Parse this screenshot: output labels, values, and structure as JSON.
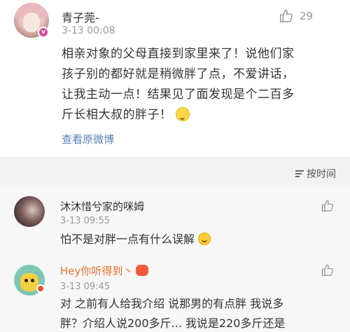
{
  "main_post": {
    "username": "青子莞-",
    "timestamp": "3-13 00:08",
    "like_count": "29",
    "text_line1": "相亲对象的父母直接到家里来了！说他们家",
    "text_line2": "孩子别的都好就是稍微胖了点，不爱讲话，",
    "text_line3": "让我主动一点！结果见了面发现是个二百多",
    "text_line4": "斤长相大叔的胖子！",
    "view_original_label": "查看原微博",
    "verified_badge": "v"
  },
  "sort_button": {
    "label": "按时间"
  },
  "comments": [
    {
      "username": "沐沐惜兮家的咪姆",
      "timestamp": "3-13 09:55",
      "text": "怕不是对胖一点有什么误解"
    },
    {
      "username": "Hey你听得到丶",
      "timestamp": "3-13 09:45",
      "text_line1": "对 之前有人给我介绍 说那男的有点胖 我说多",
      "text_line2": "胖？介绍人说200多斤... 我说是220多斤还是"
    }
  ],
  "colors": {
    "link": "#5a7fb5",
    "highlight_name": "#e8742d",
    "band": "#f2f2f2"
  }
}
